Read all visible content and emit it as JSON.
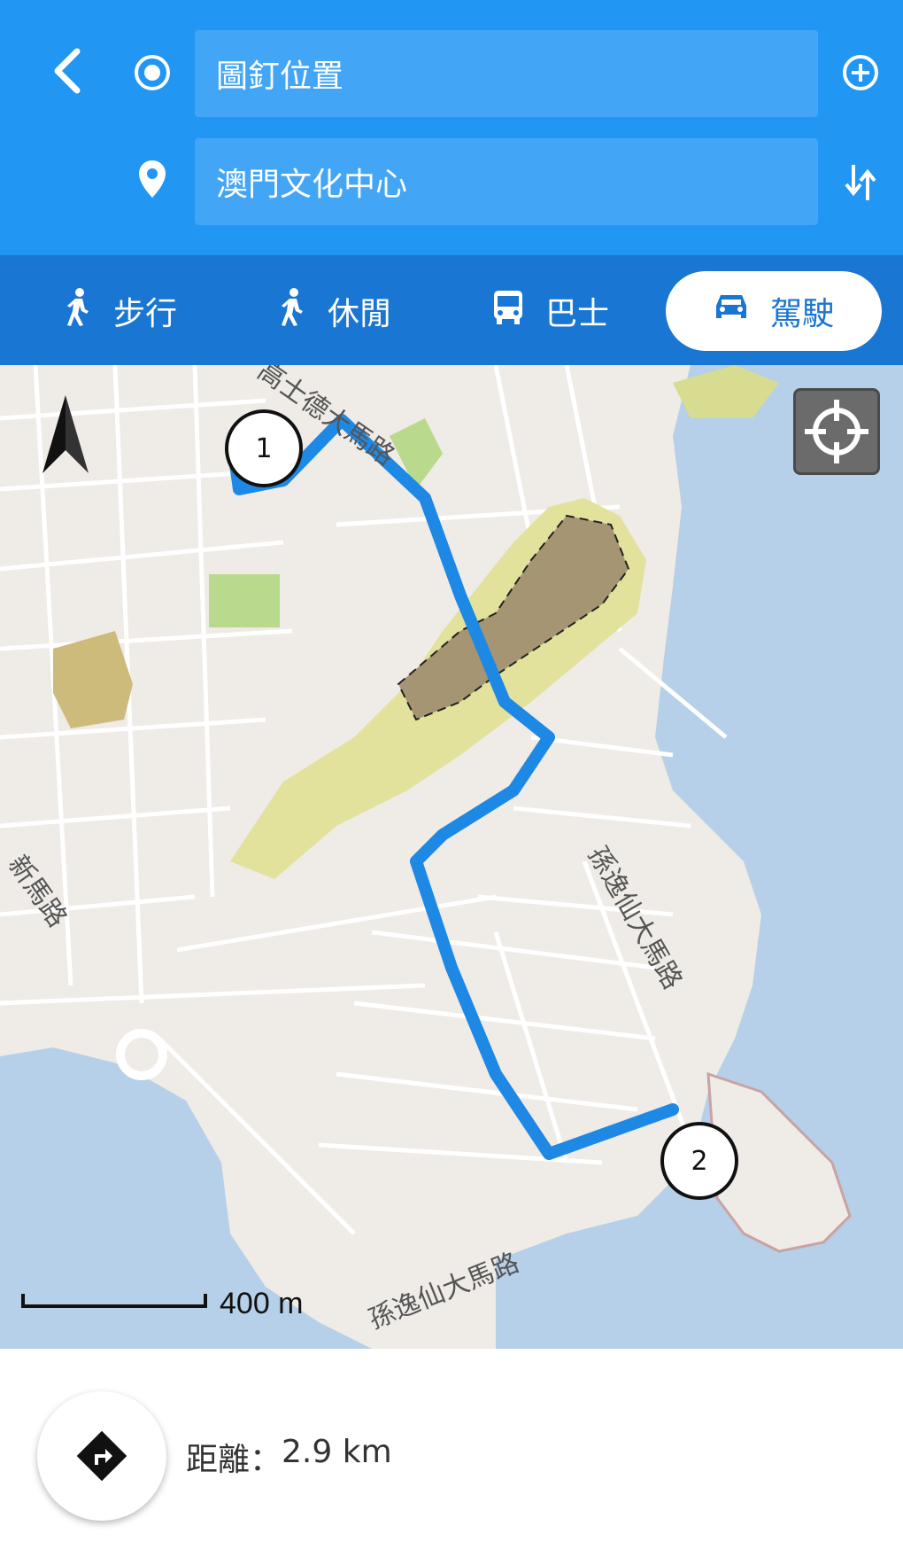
{
  "header": {
    "origin_value": "圖釘位置",
    "destination_value": "澳門文化中心"
  },
  "modes": [
    {
      "label": "步行",
      "icon": "walk-icon",
      "selected": false
    },
    {
      "label": "休閒",
      "icon": "leisure-walk-icon",
      "selected": false
    },
    {
      "label": "巴士",
      "icon": "bus-icon",
      "selected": false
    },
    {
      "label": "駕駛",
      "icon": "car-icon",
      "selected": true
    }
  ],
  "map": {
    "markers": [
      "1",
      "2"
    ],
    "scale_label": "400 m",
    "road_labels": {
      "road_a": "高士德大馬路",
      "road_b": "孫逸仙大馬路",
      "road_c": "孫逸仙大馬路",
      "road_d": "新馬路"
    },
    "colors": {
      "route": "#1e88e5",
      "water": "#b5d0e8",
      "park": "#c8e0a0",
      "hill": "#a59572"
    }
  },
  "footer": {
    "distance_label": "距離",
    "distance_value": "2.9 km"
  },
  "colors": {
    "header": "#2196f3",
    "modebar": "#1976d2",
    "field": "#42a5f5"
  }
}
